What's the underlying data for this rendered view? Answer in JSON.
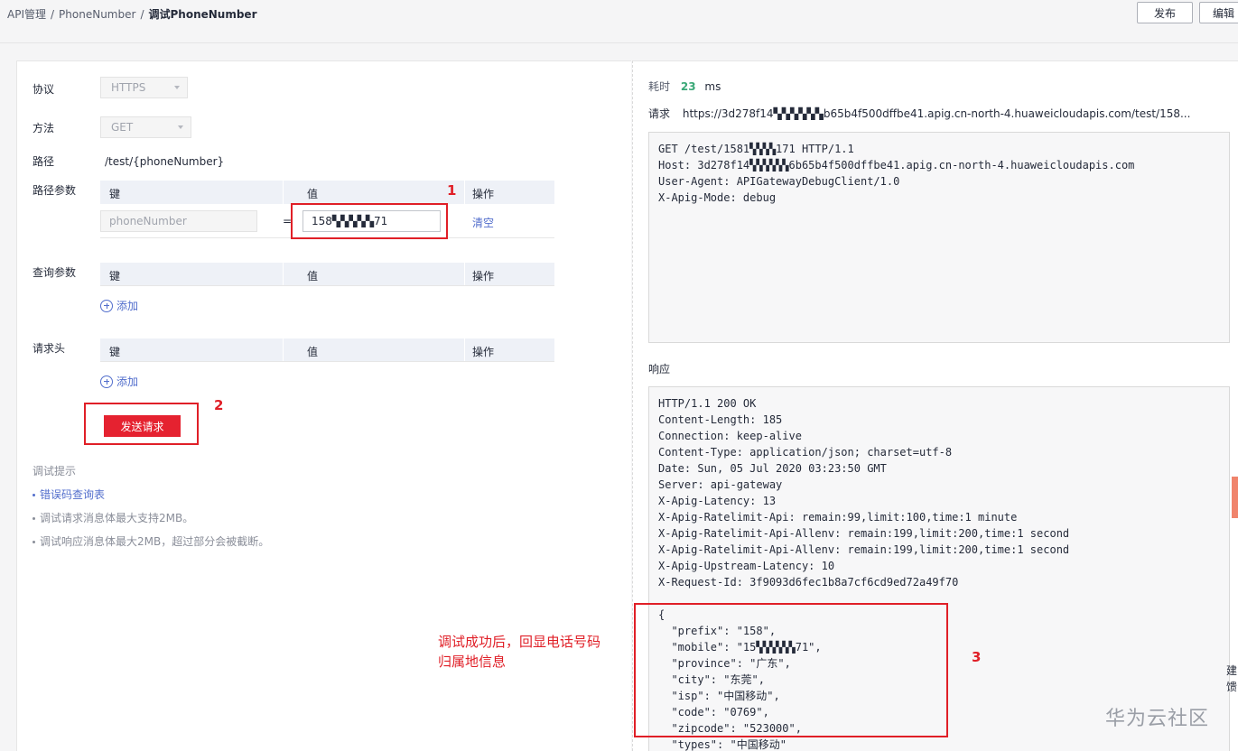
{
  "breadcrumb": {
    "root": "API管理",
    "middle": "PhoneNumber",
    "current": "调试PhoneNumber",
    "separator": "/"
  },
  "header": {
    "publish_label": "发布",
    "edit_label": "编辑"
  },
  "form": {
    "protocol_label": "协议",
    "protocol_value": "HTTPS",
    "method_label": "方法",
    "method_value": "GET",
    "path_label": "路径",
    "path_value": "/test/{phoneNumber}",
    "path_params_label": "路径参数",
    "query_params_label": "查询参数",
    "headers_label": "请求头",
    "columns": {
      "key": "键",
      "value": "值",
      "action": "操作"
    },
    "path_param": {
      "key_placeholder": "phoneNumber",
      "equals": "=",
      "value": "158▚▚▚▚▚71",
      "clear_label": "清空"
    },
    "add_label": "添加",
    "send_label": "发送请求"
  },
  "tips": {
    "title": "调试提示",
    "items": [
      "错误码查询表",
      "调试请求消息体最大支持2MB。",
      "调试响应消息体最大2MB，超过部分会被截断。"
    ]
  },
  "annotations": {
    "n1": "1",
    "n2": "2",
    "n3": "3",
    "note_line1": "调试成功后，回显电话号码",
    "note_line2": "归属地信息"
  },
  "result": {
    "latency_label": "耗时",
    "latency_value": "23",
    "latency_unit": "ms",
    "request_label": "请求",
    "request_url": "https://3d278f14▚▚▚▚▚▚b65b4f500dffbe41.apig.cn-north-4.huaweicloudapis.com/test/158...",
    "request_raw": "GET /test/1581▚▚▚▚171 HTTP/1.1\nHost: 3d278f14▚▚▚▚▚▚6b65b4f500dffbe41.apig.cn-north-4.huaweicloudapis.com\nUser-Agent: APIGatewayDebugClient/1.0\nX-Apig-Mode: debug",
    "response_label": "响应",
    "response_raw": "HTTP/1.1 200 OK\nContent-Length: 185\nConnection: keep-alive\nContent-Type: application/json; charset=utf-8\nDate: Sun, 05 Jul 2020 03:23:50 GMT\nServer: api-gateway\nX-Apig-Latency: 13\nX-Apig-Ratelimit-Api: remain:99,limit:100,time:1 minute\nX-Apig-Ratelimit-Api-Allenv: remain:199,limit:200,time:1 second\nX-Apig-Ratelimit-Api-Allenv: remain:199,limit:200,time:1 second\nX-Apig-Upstream-Latency: 10\nX-Request-Id: 3f9093d6fec1b8a7cf6cd9ed72a49f70\n\n{\n  \"prefix\": \"158\",\n  \"mobile\": \"15▚▚▚▚▚▚71\",\n  \"province\": \"广东\",\n  \"city\": \"东莞\",\n  \"isp\": \"中国移动\",\n  \"code\": \"0769\",\n  \"zipcode\": \"523000\",\n  \"types\": \"中国移动\""
  },
  "side_edge_text": "建\n馈",
  "watermark": "华为云社区"
}
